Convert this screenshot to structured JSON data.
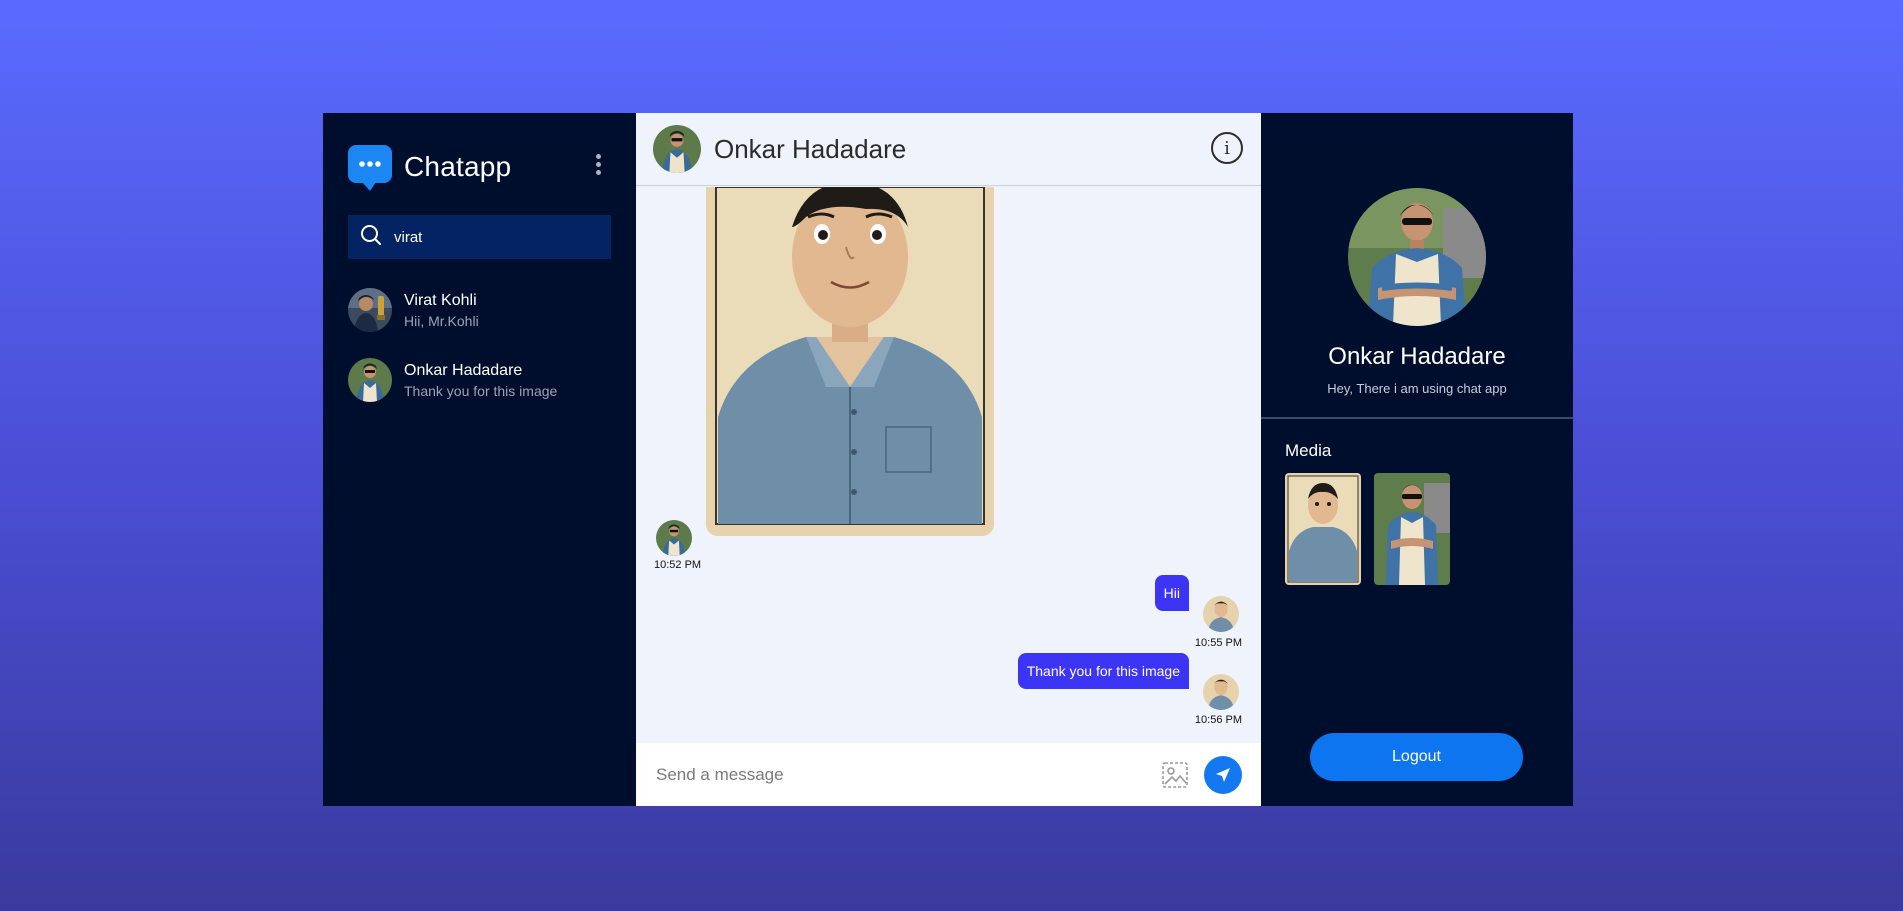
{
  "app": {
    "title": "Chatapp"
  },
  "search": {
    "value": "virat",
    "placeholder": "Search"
  },
  "contacts": [
    {
      "name": "Virat Kohli",
      "last_message": "Hii, Mr.Kohli"
    },
    {
      "name": "Onkar Hadadare",
      "last_message": "Thank you for this image"
    }
  ],
  "chat": {
    "title": "Onkar Hadadare",
    "messages": [
      {
        "type": "image",
        "from": "other",
        "time": "10:52 PM"
      },
      {
        "type": "text",
        "from": "me",
        "text": "Hii",
        "time": "10:55 PM"
      },
      {
        "type": "text",
        "from": "me",
        "text": "Thank you for this image",
        "time": "10:56 PM"
      }
    ],
    "composer_placeholder": "Send a message"
  },
  "profile": {
    "name": "Onkar Hadadare",
    "status": "Hey, There i am using chat app",
    "media_label": "Media",
    "logout_label": "Logout"
  },
  "colors": {
    "sidebar_bg": "#000e2e",
    "chat_bg": "#eff3fb",
    "bubble": "#3d35f5",
    "accent": "#1478f0",
    "search_bg": "#032363"
  }
}
